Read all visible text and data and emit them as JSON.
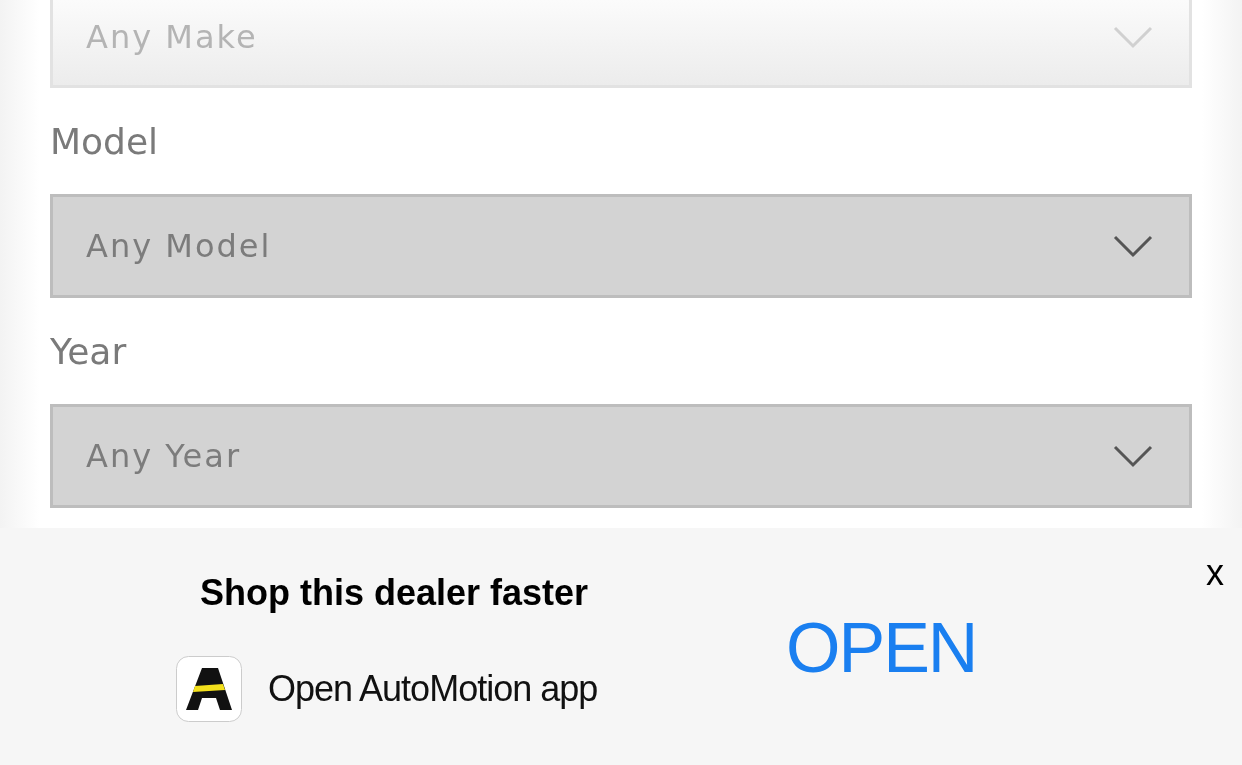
{
  "filters": [
    {
      "value": "Any Make",
      "faded": true
    },
    {
      "label": "Model",
      "value": "Any Model",
      "faded": false
    },
    {
      "label": "Year",
      "value": "Any Year",
      "faded": false
    }
  ],
  "app_banner": {
    "title": "Shop this dealer faster",
    "subtitle": "Open AutoMotion app",
    "action": "OPEN",
    "close": "x"
  }
}
